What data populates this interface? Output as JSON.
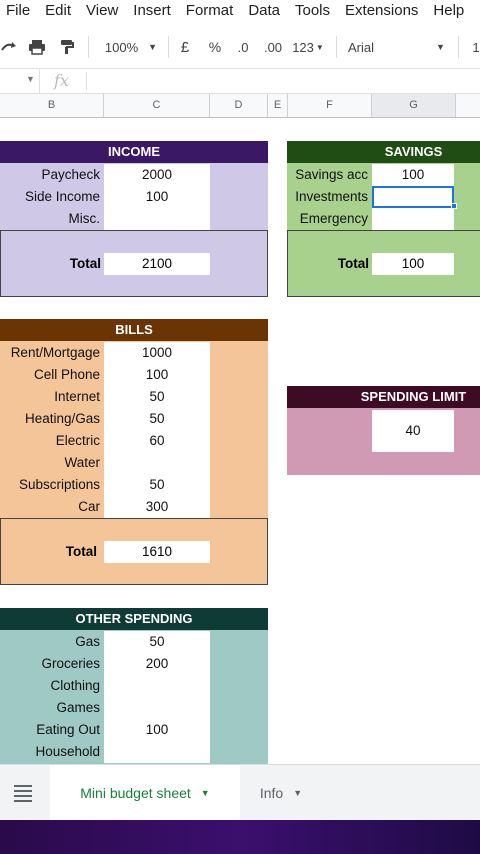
{
  "menu": [
    "File",
    "Edit",
    "View",
    "Insert",
    "Format",
    "Data",
    "Tools",
    "Extensions",
    "Help"
  ],
  "toolbar": {
    "zoom": "100%",
    "currency": "£",
    "percent": "%",
    "dec_decrease": ".0",
    "dec_increase": ".00",
    "format_more": "123",
    "font": "Arial",
    "fx": "fx"
  },
  "columns": [
    "B",
    "C",
    "D",
    "E",
    "F",
    "G"
  ],
  "income": {
    "title": "INCOME",
    "rows": [
      {
        "label": "Paycheck",
        "value": "2000"
      },
      {
        "label": "Side Income",
        "value": "100"
      },
      {
        "label": "Misc.",
        "value": ""
      }
    ],
    "total_label": "Total",
    "total_value": "2100"
  },
  "savings": {
    "title": "SAVINGS",
    "rows": [
      {
        "label": "Savings acc",
        "value": "100"
      },
      {
        "label": "Investments",
        "value": ""
      },
      {
        "label": "Emergency",
        "value": ""
      }
    ],
    "total_label": "Total",
    "total_value": "100"
  },
  "bills": {
    "title": "BILLS",
    "rows": [
      {
        "label": "Rent/Mortgage",
        "value": "1000"
      },
      {
        "label": "Cell Phone",
        "value": "100"
      },
      {
        "label": "Internet",
        "value": "50"
      },
      {
        "label": "Heating/Gas",
        "value": "50"
      },
      {
        "label": "Electric",
        "value": "60"
      },
      {
        "label": "Water",
        "value": ""
      },
      {
        "label": "Subscriptions",
        "value": "50"
      },
      {
        "label": "Car",
        "value": "300"
      }
    ],
    "total_label": "Total",
    "total_value": "1610"
  },
  "spending_limit": {
    "title": "SPENDING LIMIT",
    "value": "40"
  },
  "other": {
    "title": "OTHER SPENDING",
    "rows": [
      {
        "label": "Gas",
        "value": "50"
      },
      {
        "label": "Groceries",
        "value": "200"
      },
      {
        "label": "Clothing",
        "value": ""
      },
      {
        "label": "Games",
        "value": ""
      },
      {
        "label": "Eating Out",
        "value": "100"
      },
      {
        "label": "Household",
        "value": ""
      }
    ]
  },
  "sheets": {
    "active": "Mini budget sheet",
    "other": "Info"
  },
  "colors": {
    "income_head": "#3a1866",
    "income_body": "#cfc8e6",
    "savings_head": "#1f4d14",
    "savings_body": "#a8d18d",
    "bills_head": "#6b3405",
    "bills_body": "#f5c59a",
    "limit_head": "#3d0b24",
    "limit_body": "#d09ab5",
    "other_head": "#0f3b36",
    "other_body": "#9ec9c4",
    "sheet_active": "#188038",
    "selection": "#1a73e8"
  }
}
